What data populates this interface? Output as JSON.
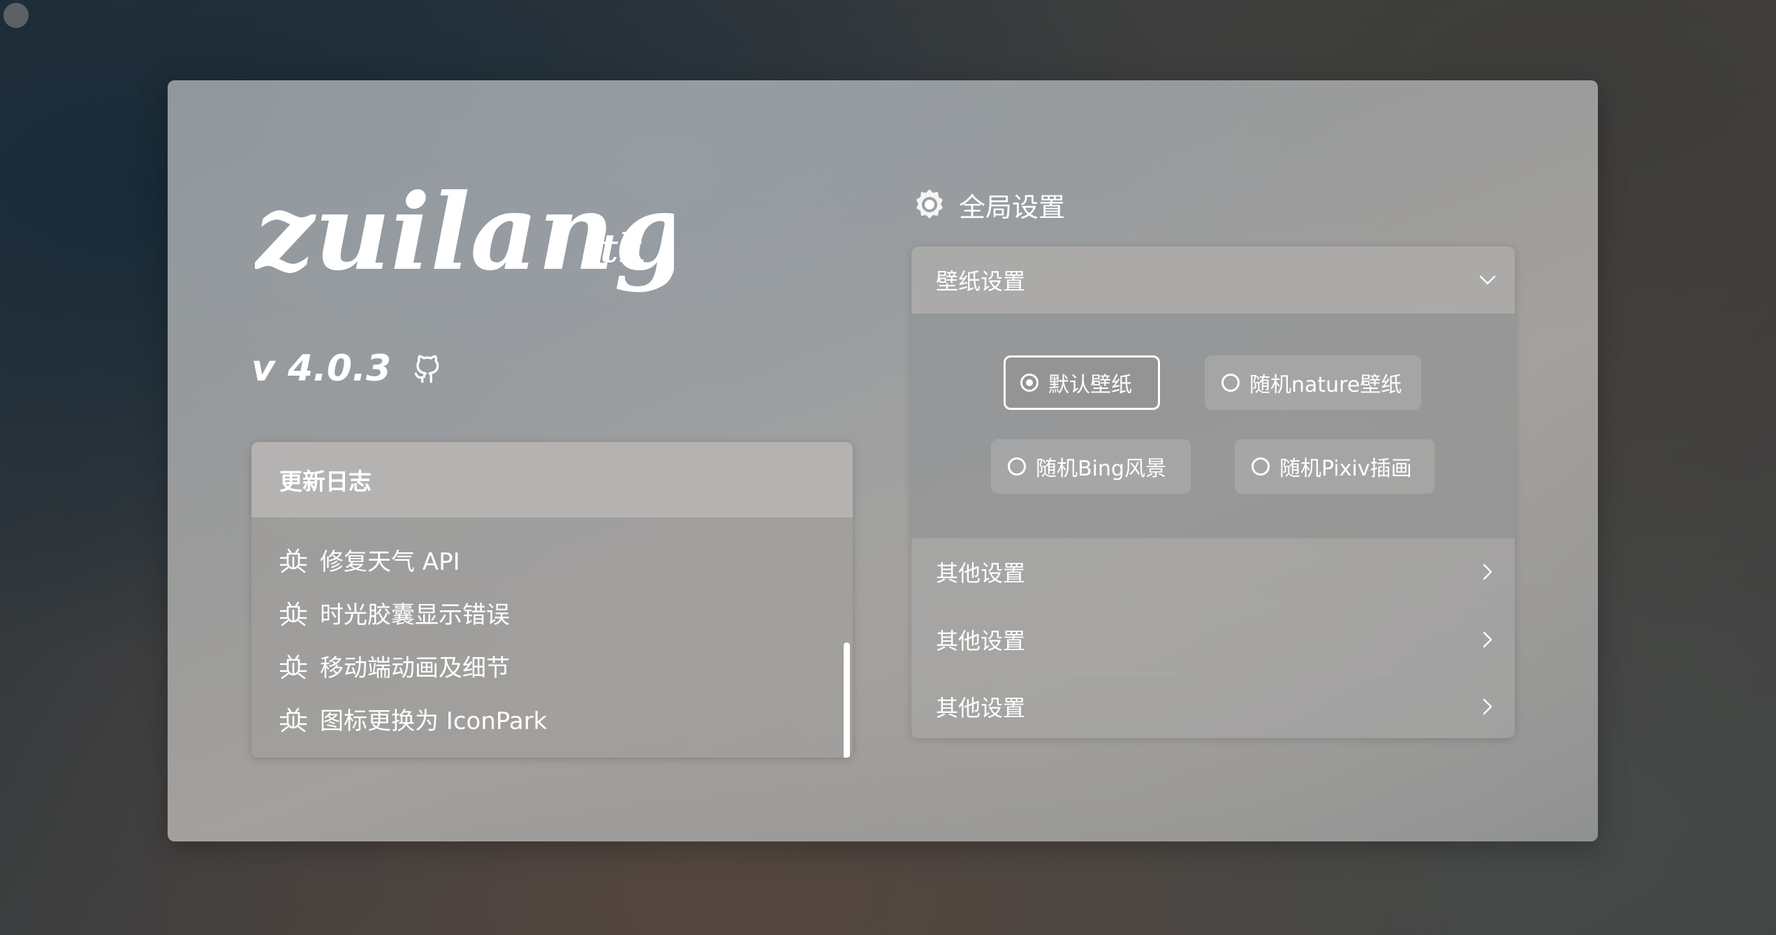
{
  "brand": {
    "logo_text": "zuilang",
    "logo_suffix": ".tk",
    "version": "v 4.0.3"
  },
  "changelog": {
    "title": "更新日志",
    "items": [
      {
        "icon": "bug-icon",
        "text": "修复天气 API"
      },
      {
        "icon": "bug-icon",
        "text": "时光胶囊显示错误"
      },
      {
        "icon": "bug-icon",
        "text": "移动端动画及细节"
      },
      {
        "icon": "bug-icon",
        "text": "图标更换为 IconPark"
      }
    ]
  },
  "settings": {
    "title": "全局设置",
    "wallpaper": {
      "label": "壁纸设置",
      "expanded": true,
      "options": [
        {
          "label": "默认壁纸",
          "selected": true
        },
        {
          "label": "随机nature壁纸",
          "selected": false
        },
        {
          "label": "随机Bing风景",
          "selected": false
        },
        {
          "label": "随机Pixiv插画",
          "selected": false
        }
      ]
    },
    "other_sections": [
      {
        "label": "其他设置"
      },
      {
        "label": "其他设置"
      },
      {
        "label": "其他设置"
      }
    ]
  },
  "colors": {
    "text": "#ffffff",
    "panel": "#9a9b9b"
  }
}
